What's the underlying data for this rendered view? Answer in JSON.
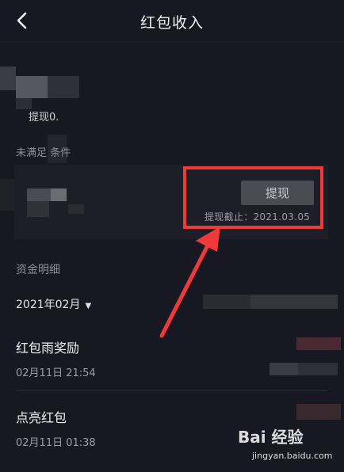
{
  "header": {
    "title": "红包收入",
    "back_icon": "back-chevron-icon"
  },
  "balance": {
    "withdraw_hint": "提现0.",
    "condition_label": "未满足        条件"
  },
  "card": {
    "withdraw_button": "提现",
    "deadline": "提现截止：2021.03.05"
  },
  "annotation": {
    "color": "#f03a3a"
  },
  "details": {
    "section_title": "资金明细",
    "month": "2021年02月",
    "records": [
      {
        "title": "红包雨奖励",
        "time": "02月11日 21:54"
      },
      {
        "title": "点亮红包",
        "time": "02月11日 01:38"
      }
    ]
  },
  "watermark": {
    "logo": "Bai 经验",
    "url": "jingyan.baidu.com"
  }
}
